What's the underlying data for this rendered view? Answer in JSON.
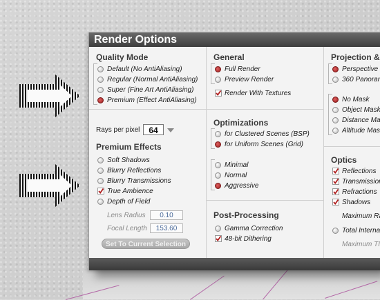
{
  "window": {
    "title": "Render Options"
  },
  "quality_mode": {
    "heading": "Quality Mode",
    "options": [
      {
        "label": "Default (No AntiAliasing)",
        "selected": false
      },
      {
        "label": "Regular (Normal AntiAliasing)",
        "selected": false
      },
      {
        "label": "Super (Fine Art AntiAliasing)",
        "selected": false
      },
      {
        "label": "Premium (Effect AntiAliasing)",
        "selected": true
      }
    ]
  },
  "rays": {
    "label": "Rays per pixel",
    "value": "64"
  },
  "premium_effects": {
    "heading": "Premium Effects",
    "options": [
      {
        "label": "Soft Shadows",
        "selected": false
      },
      {
        "label": "Blurry Reflections",
        "selected": false
      },
      {
        "label": "Blurry Transmissions",
        "selected": false
      },
      {
        "label": "True Ambience",
        "checked": true
      },
      {
        "label": "Depth of Field",
        "selected": false
      }
    ],
    "lens_radius": {
      "label": "Lens Radius",
      "value": "0.10"
    },
    "focal_length": {
      "label": "Focal Length",
      "value": "153.60"
    },
    "set_button": "Set To Current Selection"
  },
  "general": {
    "heading": "General",
    "options": [
      {
        "label": "Full Render",
        "selected": true
      },
      {
        "label": "Preview Render",
        "selected": false
      },
      {
        "label": "Render With Textures",
        "checked": true
      }
    ]
  },
  "optimizations": {
    "heading": "Optimizations",
    "scene_options": [
      {
        "label": "for Clustered Scenes (BSP)",
        "selected": false
      },
      {
        "label": "for Uniform Scenes (Grid)",
        "selected": true
      }
    ],
    "level_options": [
      {
        "label": "Minimal",
        "selected": false
      },
      {
        "label": "Normal",
        "selected": false
      },
      {
        "label": "Aggressive",
        "selected": true
      }
    ]
  },
  "post_processing": {
    "heading": "Post-Processing",
    "options": [
      {
        "label": "Gamma Correction",
        "selected": false
      },
      {
        "label": "48-bit Dithering",
        "checked": true
      }
    ]
  },
  "projection": {
    "heading": "Projection &",
    "options": [
      {
        "label": "Perspective P",
        "selected": true
      },
      {
        "label": "360  Panoran",
        "selected": false
      }
    ],
    "mask_options": [
      {
        "label": "No Mask",
        "selected": true
      },
      {
        "label": "Object Mask",
        "selected": false
      },
      {
        "label": "Distance Mas",
        "selected": false
      },
      {
        "label": "Altitude Mask",
        "selected": false
      }
    ]
  },
  "optics": {
    "heading": "Optics",
    "options": [
      {
        "label": "Reflections",
        "checked": true
      },
      {
        "label": "Transmission",
        "checked": true
      },
      {
        "label": "Refractions",
        "checked": true
      },
      {
        "label": "Shadows",
        "checked": true
      }
    ],
    "max_ray_label": "Maximum Ra",
    "total_internal_label": "Total Internal",
    "max_tir_label": "Maximum TI"
  },
  "colors": {
    "accent": "#b01e1e",
    "title_bar": "#4a4a4a"
  }
}
